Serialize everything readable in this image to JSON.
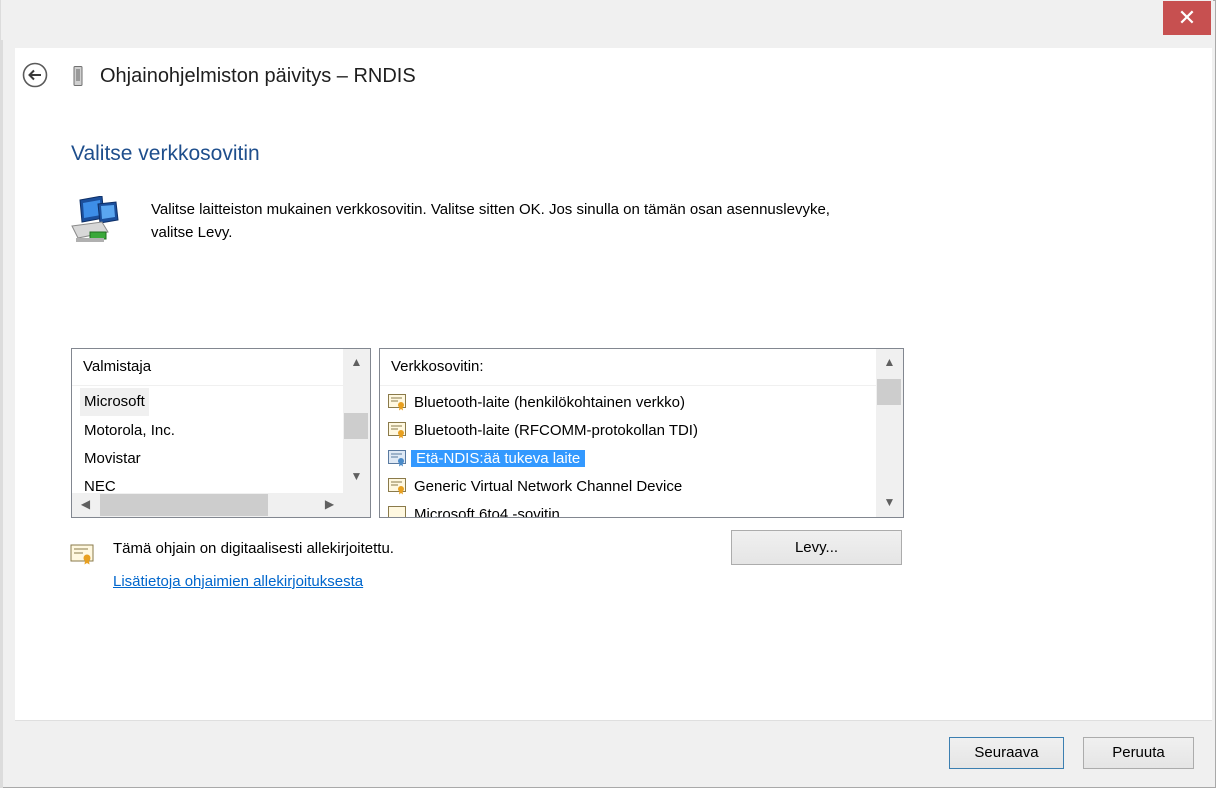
{
  "window": {
    "title": "Ohjainohjelmiston päivitys – RNDIS",
    "close_glyph": "✕"
  },
  "page": {
    "heading": "Valitse verkkosovitin",
    "instruction": "Valitse laitteiston mukainen verkkosovitin. Valitse sitten OK. Jos sinulla on tämän osan asennuslevyke, valitse Levy."
  },
  "manufacturers": {
    "header": "Valmistaja",
    "items": [
      {
        "label": "Microsoft",
        "selected": true
      },
      {
        "label": "Motorola, Inc.",
        "selected": false
      },
      {
        "label": "Movistar",
        "selected": false
      },
      {
        "label": "NEC",
        "selected": false
      }
    ]
  },
  "adapters": {
    "header": "Verkkosovitin:",
    "items": [
      {
        "label": "Bluetooth-laite (henkilökohtainen verkko)",
        "icon": "certificate-icon",
        "selected": false
      },
      {
        "label": "Bluetooth-laite (RFCOMM-protokollan TDI)",
        "icon": "certificate-icon",
        "selected": false
      },
      {
        "label": "Etä-NDIS:ää tukeva laite",
        "icon": "certificate-icon",
        "selected": true
      },
      {
        "label": "Generic Virtual Network Channel Device",
        "icon": "certificate-icon",
        "selected": false
      },
      {
        "label": "Microsoft 6to4 -sovitin",
        "icon": "certificate-icon",
        "selected": false
      }
    ]
  },
  "signature": {
    "text": "Tämä ohjain on digitaalisesti allekirjoitettu.",
    "link": "Lisätietoja ohjaimien allekirjoituksesta"
  },
  "buttons": {
    "disk": "Levy...",
    "next": "Seuraava",
    "cancel": "Peruuta"
  },
  "colors": {
    "heading": "#1e4e8c",
    "selection": "#3399ff",
    "link": "#0066cc",
    "close": "#c75050"
  }
}
